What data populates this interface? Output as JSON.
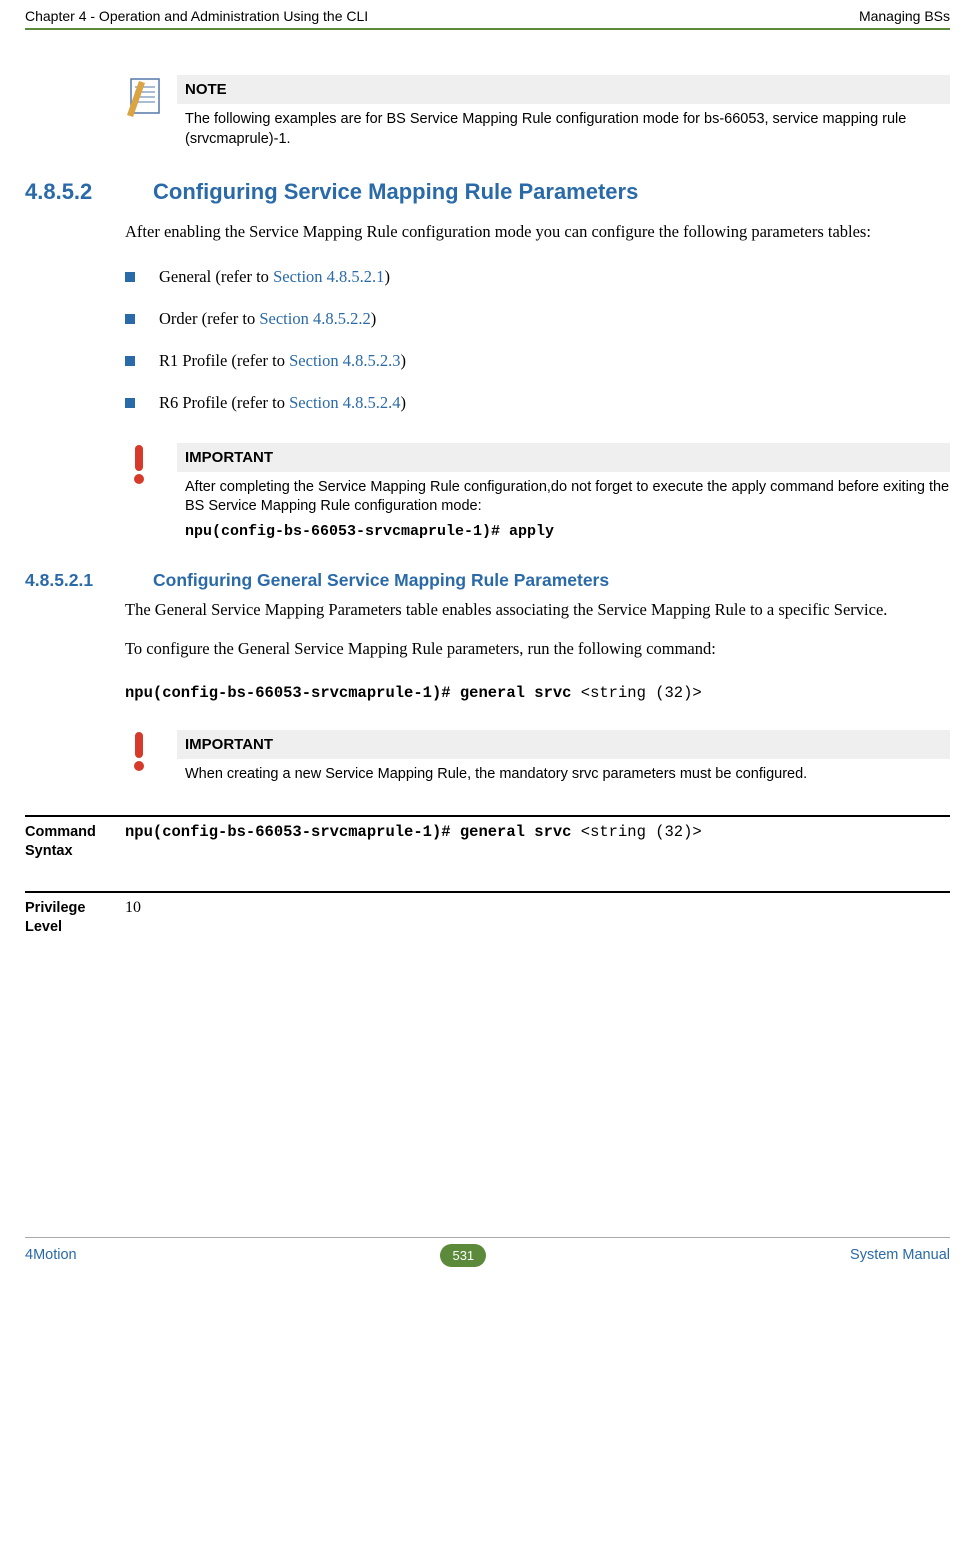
{
  "header": {
    "left": "Chapter 4 - Operation and Administration Using the CLI",
    "right": "Managing BSs"
  },
  "noteBlocks": {
    "note1": {
      "title": "NOTE",
      "text": "The following examples are for BS Service Mapping Rule configuration mode for bs-66053, service mapping rule (srvcmaprule)-1."
    },
    "important1": {
      "title": "IMPORTANT",
      "text": "After completing the Service Mapping Rule configuration,do not forget to execute the apply command before exiting the BS Service Mapping Rule configuration mode:",
      "cmd": "npu(config-bs-66053-srvcmaprule-1)# apply"
    },
    "important2": {
      "title": "IMPORTANT",
      "text": "When creating a new Service Mapping Rule, the mandatory srvc parameters must be configured."
    }
  },
  "sections": {
    "s48_5_2": {
      "num": "4.8.5.2",
      "title": "Configuring Service Mapping Rule Parameters",
      "intro": "After enabling the Service Mapping Rule configuration mode you can configure the following parameters tables:",
      "bullets": [
        {
          "prefix": "General (refer to ",
          "link": "Section 4.8.5.2.1",
          "suffix": ")"
        },
        {
          "prefix": "Order (refer to ",
          "link": "Section 4.8.5.2.2",
          "suffix": ")"
        },
        {
          "prefix": "R1 Profile (refer to ",
          "link": "Section 4.8.5.2.3",
          "suffix": ")"
        },
        {
          "prefix": "R6 Profile (refer to ",
          "link": "Section 4.8.5.2.4",
          "suffix": ")"
        }
      ]
    },
    "s48_5_2_1": {
      "num": "4.8.5.2.1",
      "title": "Configuring General Service Mapping Rule Parameters",
      "p1": "The General Service Mapping Parameters table enables associating the Service Mapping Rule to a specific Service.",
      "p2": "To configure the General Service Mapping Rule parameters, run the following command:",
      "cmdBold": "npu(config-bs-66053-srvcmaprule-1)# general srvc ",
      "cmdArg": "<string (32)>"
    }
  },
  "defs": {
    "commandSyntax": {
      "label": "Command Syntax",
      "valueBold": "npu(config-bs-66053-srvcmaprule-1)# general srvc ",
      "valueArg": "<string (32)>"
    },
    "privilegeLevel": {
      "label": "Privilege Level",
      "value": "10"
    }
  },
  "footer": {
    "left": "4Motion",
    "page": "531",
    "right": "System Manual"
  }
}
